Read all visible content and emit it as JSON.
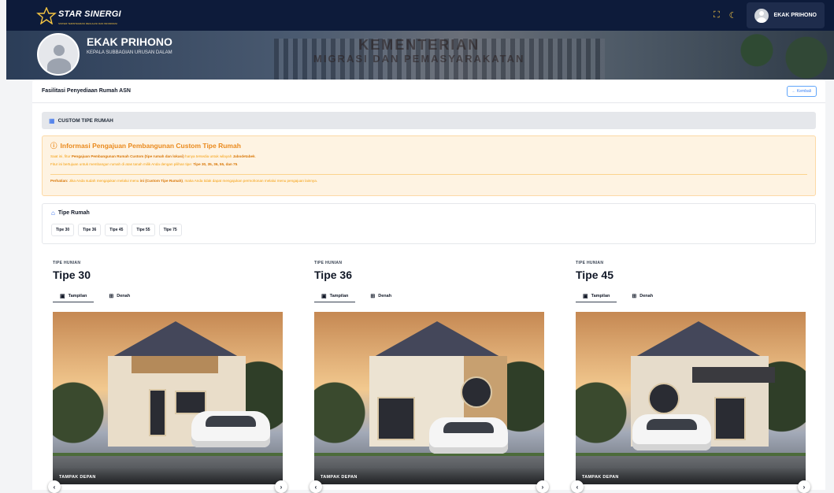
{
  "brand": {
    "name": "STAR SINERGI",
    "tagline": "SISTEM TERINTEGRASI REGULASI DAN INFORMASI"
  },
  "topbar": {
    "icons": [
      "expand-icon",
      "moon-icon"
    ],
    "user_name": "EKAK PRIHONO"
  },
  "banner": {
    "building_text_line1": "KEMENTERIAN",
    "building_text_line2": "MIGRASI DAN PEMASYARAKATAN"
  },
  "profile": {
    "name": "EKAK PRIHONO",
    "role": "KEPALA SUBBAGIAN URUSAN DALAM"
  },
  "page": {
    "title": "Fasilitasi Penyediaan Rumah ASN",
    "back_label": "← Kembali"
  },
  "section": {
    "title": "CUSTOM TIPE RUMAH"
  },
  "info": {
    "title": "Informasi Pengajuan Pembangunan Custom Tipe Rumah",
    "line1_a": "Saat ini, fitur ",
    "line1_b": "Pengajuan Pembangunan Rumah Custom (tipe rumah dan lokasi)",
    "line1_c": " hanya tersedia untuk wilayah ",
    "line1_d": "Jabodetabek",
    "line1_e": ".",
    "line2_a": "Fitur ini bertujuan untuk membangun rumah di atas tanah milik Anda dengan pilihan tipe: ",
    "line2_b": "Tipe 30, 35, 36, 55, dan 75",
    "line2_c": ".",
    "warn_a": "Perhatian:",
    "warn_b": " Jika Anda sudah mengajukan melalui menu ",
    "warn_c": "ini (Custom Tipe Rumah)",
    "warn_d": ", maka Anda tidak dapat mengajukan permohonan melalui menu pengajuan lainnya."
  },
  "types": {
    "title": "Tipe Rumah",
    "chips": [
      "Tipe 30",
      "Tipe 36",
      "Tipe 45",
      "Tipe 55",
      "Tipe 75"
    ]
  },
  "houses": [
    {
      "kicker": "TIPE HUNIAN",
      "name": "Tipe 30",
      "tab_view": "Tampilan",
      "tab_plan": "Denah",
      "photo_label": "TAMPAK DEPAN"
    },
    {
      "kicker": "TIPE HUNIAN",
      "name": "Tipe 36",
      "tab_view": "Tampilan",
      "tab_plan": "Denah",
      "photo_label": "TAMPAK DEPAN"
    },
    {
      "kicker": "TIPE HUNIAN",
      "name": "Tipe 45",
      "tab_view": "Tampilan",
      "tab_plan": "Denah",
      "photo_label": "TAMPAK DEPAN"
    }
  ],
  "colors": {
    "topbar": "#0d1b3a",
    "accent": "#2563eb",
    "warning": "#ea8a1d"
  }
}
